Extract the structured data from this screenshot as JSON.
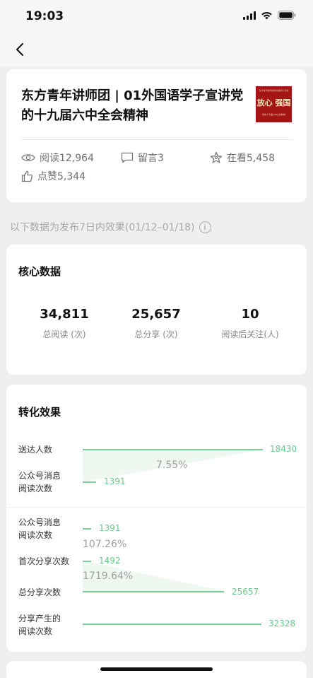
{
  "status": {
    "time": "19:03"
  },
  "article": {
    "title": "东方青年讲师团 | 01外国语学子宣讲党的十九届六中全会精神",
    "thumbnail": {
      "big_text": "放心 强国",
      "small_top": "东方青年讲师团外国语学子宣讲",
      "small_bottom": "党的十九届六中全会精神"
    },
    "stats": {
      "read": "阅读12,964",
      "comment": "留言3",
      "watching": "在看5,458",
      "like": "点赞5,344"
    }
  },
  "note": "以下数据为发布7日内效果(01/12–01/18)",
  "core": {
    "title": "核心数据",
    "metrics": [
      {
        "value": "34,811",
        "label": "总阅读 (次)"
      },
      {
        "value": "25,657",
        "label": "总分享 (次)"
      },
      {
        "value": "10",
        "label": "阅读后关注(人)"
      }
    ]
  },
  "conversion": {
    "title": "转化效果",
    "rows": [
      {
        "label1": "送达人数",
        "label2": "",
        "value": "18430"
      },
      {
        "label1": "公众号消息",
        "label2": "阅读次数",
        "value": "1391"
      },
      {
        "label1": "公众号消息",
        "label2": "阅读次数",
        "value": "1391"
      },
      {
        "label1": "首次分享次数",
        "label2": "",
        "value": "1492"
      },
      {
        "label1": "总分享次数",
        "label2": "",
        "value": "25657"
      },
      {
        "label1": "分享产生的",
        "label2": "阅读次数",
        "value": "32328"
      }
    ],
    "rates": {
      "read_rate": "7.55%",
      "share_rate": "107.26%",
      "spread_rate": "1719.64%"
    }
  },
  "colors": {
    "accent": "#79cf97",
    "value_text": "#6bc78a",
    "background": "#efefef"
  }
}
